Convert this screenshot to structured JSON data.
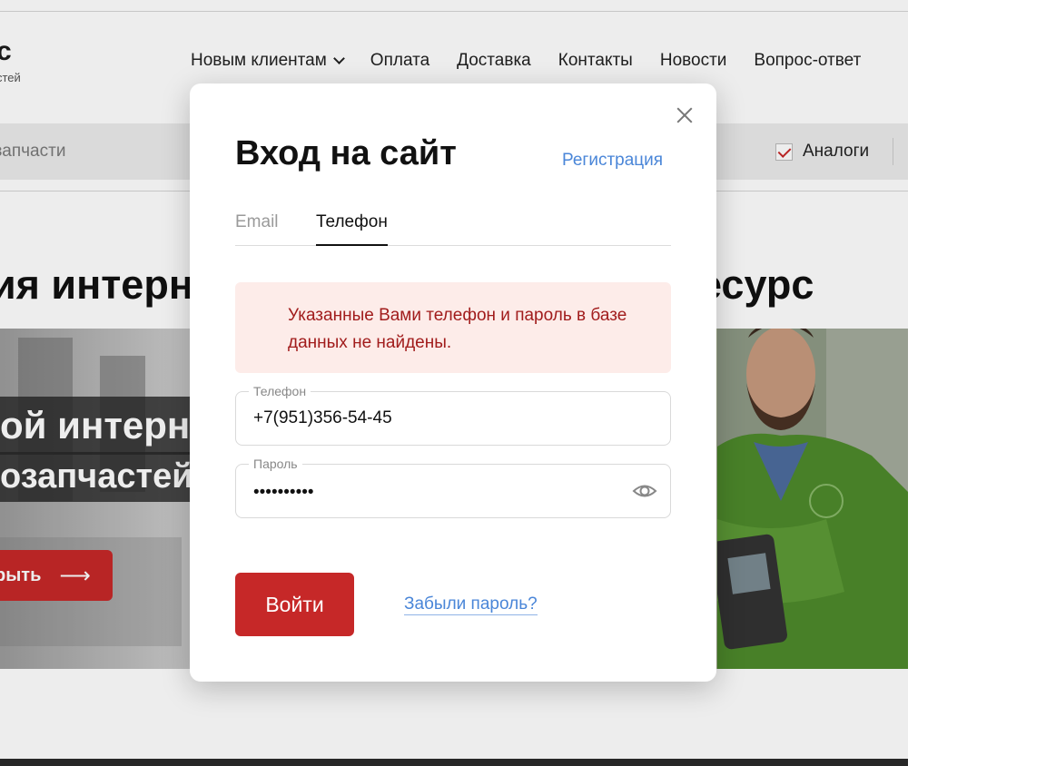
{
  "site": {
    "logo_fragment": "с",
    "logo_sub_fragment": "стей",
    "nav": [
      {
        "label": "Новым клиентам"
      },
      {
        "label": "Оплата"
      },
      {
        "label": "Доставка"
      },
      {
        "label": "Контакты"
      },
      {
        "label": "Новости"
      },
      {
        "label": "Вопрос-ответ"
      }
    ],
    "search_placeholder": "к запчасти",
    "analog_label": "Аналоги",
    "hero_left": "ия интерн",
    "hero_right": "есурс",
    "banner_line1": "ой интерн",
    "banner_line2": "озапчастей",
    "banner_button": "рыть",
    "banner_button_arrow": "⟶"
  },
  "modal": {
    "title": "Вход на сайт",
    "register_link": "Регистрация",
    "tabs": [
      {
        "label": "Email",
        "active": false
      },
      {
        "label": "Телефон",
        "active": true
      }
    ],
    "error_message": "Указанные Вами телефон и пароль в базе данных не найдены.",
    "phone_label": "Телефон",
    "phone_value": "+7(951)356-54-45",
    "password_label": "Пароль",
    "password_mask": "••••••••••",
    "login_button": "Войти",
    "forgot_link": "Забыли пароль?"
  },
  "colors": {
    "accent_red": "#c62828",
    "link_blue": "#4a86d8",
    "error_bg": "#fdece9",
    "error_text": "#a11c1c"
  },
  "icons": [
    "close-icon",
    "eye-icon",
    "checkbox-check-icon",
    "chevron-down-icon",
    "arrow-right-icon"
  ]
}
